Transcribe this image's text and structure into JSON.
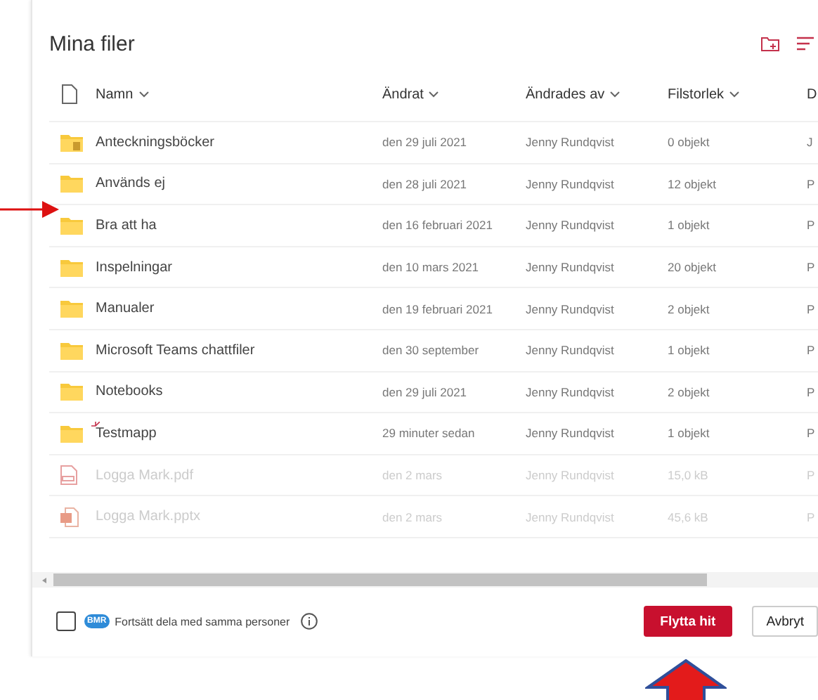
{
  "title": "Mina filer",
  "columns": [
    "Namn",
    "Ändrat",
    "Ändrades av",
    "Filstorlek",
    "D"
  ],
  "rows": [
    {
      "kind": "notebook-folder",
      "name": "Anteckningsböcker",
      "modified": "den 29 juli 2021",
      "modified_by": "Jenny Rundqvist",
      "size": "0 objekt",
      "column_5": "J",
      "disabled": false,
      "new": false
    },
    {
      "kind": "folder",
      "name": "Används ej",
      "modified": "den 28 juli 2021",
      "modified_by": "Jenny Rundqvist",
      "size": "12 objekt",
      "column_5": "P",
      "disabled": false,
      "new": false
    },
    {
      "kind": "folder",
      "name": "Bra att ha",
      "modified": "den 16 februari 2021",
      "modified_by": "Jenny Rundqvist",
      "size": "1 objekt",
      "column_5": "P",
      "disabled": false,
      "new": false
    },
    {
      "kind": "folder",
      "name": "Inspelningar",
      "modified": "den 10 mars 2021",
      "modified_by": "Jenny Rundqvist",
      "size": "20 objekt",
      "column_5": "P",
      "disabled": false,
      "new": false
    },
    {
      "kind": "folder",
      "name": "Manualer",
      "modified": "den 19 februari 2021",
      "modified_by": "Jenny Rundqvist",
      "size": "2 objekt",
      "column_5": "P",
      "disabled": false,
      "new": false
    },
    {
      "kind": "folder",
      "name": "Microsoft Teams chattfiler",
      "modified": "den 30 september",
      "modified_by": "Jenny Rundqvist",
      "size": "1 objekt",
      "column_5": "P",
      "disabled": false,
      "new": false
    },
    {
      "kind": "folder",
      "name": "Notebooks",
      "modified": "den 29 juli 2021",
      "modified_by": "Jenny Rundqvist",
      "size": "2 objekt",
      "column_5": "P",
      "disabled": false,
      "new": false
    },
    {
      "kind": "folder",
      "name": "Testmapp",
      "modified": "29 minuter sedan",
      "modified_by": "Jenny Rundqvist",
      "size": "1 objekt",
      "column_5": "P",
      "disabled": false,
      "new": true
    },
    {
      "kind": "pdf",
      "name": "Logga Mark.pdf",
      "modified": "den 2 mars",
      "modified_by": "Jenny Rundqvist",
      "size": "15,0 kB",
      "column_5": "P",
      "disabled": true,
      "new": false
    },
    {
      "kind": "pptx",
      "name": "Logga Mark.pptx",
      "modified": "den 2 mars",
      "modified_by": "Jenny Rundqvist",
      "size": "45,6 kB",
      "column_5": "P",
      "disabled": true,
      "new": false
    }
  ],
  "footer": {
    "checked": false,
    "avatar": "BMR",
    "label": "Fortsätt dela med samma personer"
  },
  "buttons": [
    {
      "kind": "primary",
      "label": "Flytta hit"
    },
    {
      "kind": "secondary",
      "label": "Avbryt"
    }
  ]
}
